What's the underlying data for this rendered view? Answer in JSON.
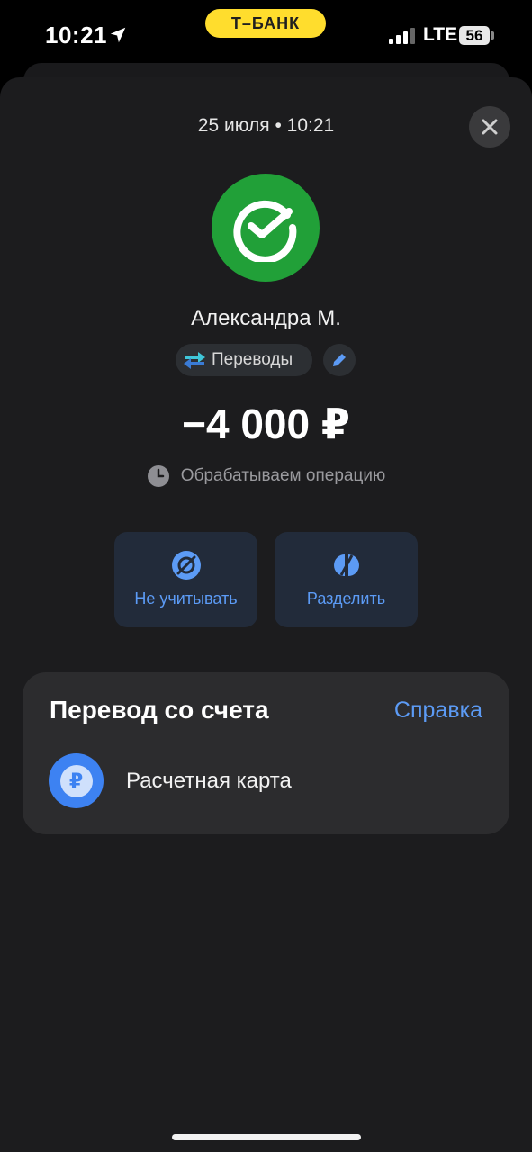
{
  "status_bar": {
    "time": "10:21",
    "brand": "Т–БАНК",
    "network": "LTE",
    "battery": "56"
  },
  "header": {
    "date": "25 июля • 10:21"
  },
  "transaction": {
    "counterparty": "Александра М.",
    "category": "Переводы",
    "amount": "−4 000 ₽",
    "status": "Обрабатываем операцию"
  },
  "actions": [
    {
      "label": "Не учитывать",
      "icon": "ignore-icon"
    },
    {
      "label": "Разделить",
      "icon": "split-icon"
    }
  ],
  "source_card": {
    "title": "Перевод со счета",
    "help_link": "Справка",
    "account_name": "Расчетная карта",
    "account_icon_symbol": "₽"
  },
  "colors": {
    "accent": "#5c9bf5",
    "sber_green": "#21a038",
    "brand_yellow": "#ffdd2d"
  }
}
